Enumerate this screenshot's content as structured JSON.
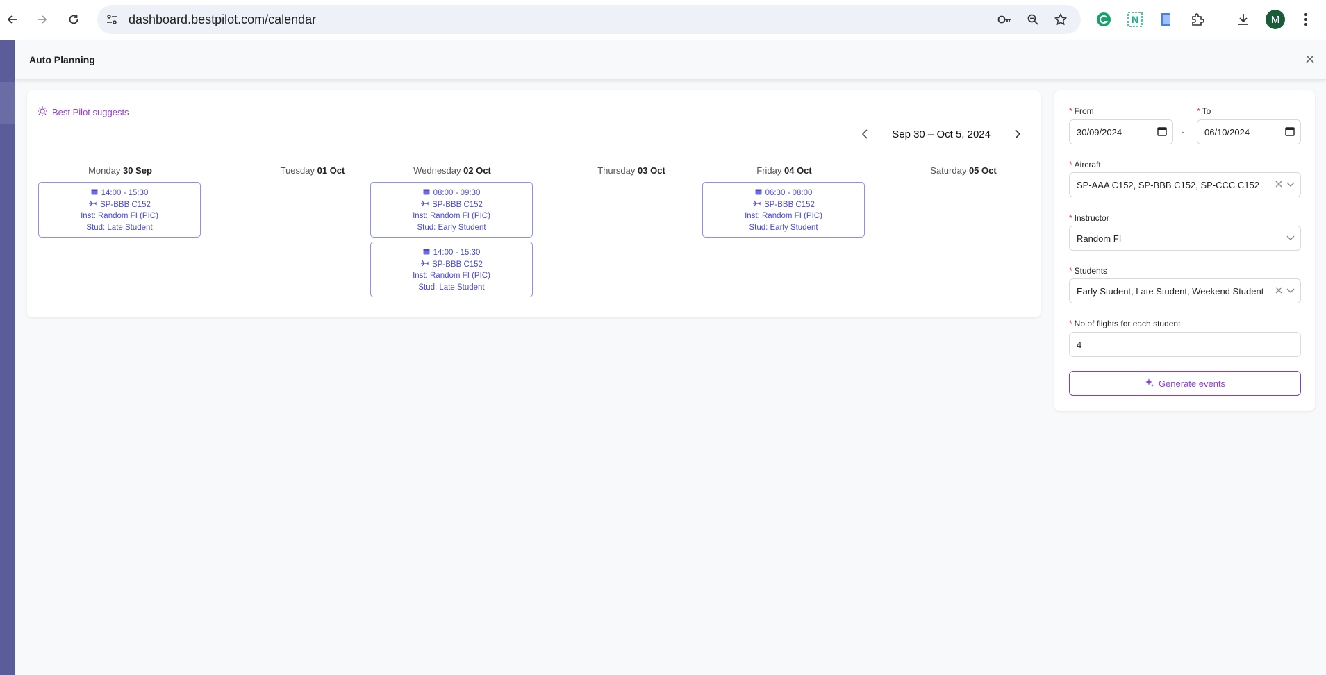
{
  "browser": {
    "url": "dashboard.bestpilot.com/calendar",
    "profile_initial": "M",
    "icons": [
      "back-icon",
      "forward-icon",
      "reload-icon",
      "site-settings-icon",
      "password-key-icon",
      "zoom-icon",
      "bookmark-star-icon",
      "grammarly-icon",
      "notion-icon",
      "extension-icon",
      "puzzle-icon",
      "download-icon",
      "menu-kebab-icon"
    ]
  },
  "drawer": {
    "title": "Auto Planning"
  },
  "calendar": {
    "suggest_label": "Best Pilot suggests",
    "week_range": "Sep 30 – Oct 5, 2024",
    "days": [
      {
        "weekday": "Monday",
        "date": "30 Sep"
      },
      {
        "weekday": "Tuesday",
        "date": "01 Oct"
      },
      {
        "weekday": "Wednesday",
        "date": "02 Oct"
      },
      {
        "weekday": "Thursday",
        "date": "03 Oct"
      },
      {
        "weekday": "Friday",
        "date": "04 Oct"
      },
      {
        "weekday": "Saturday",
        "date": "05 Oct"
      }
    ],
    "events": [
      {
        "day": "Monday",
        "time": "14:00 - 15:30",
        "aircraft": "SP-BBB C152",
        "inst": "Inst: Random FI (PIC)",
        "stud": "Stud: Late Student"
      },
      {
        "day": "Wednesday",
        "time": "08:00 - 09:30",
        "aircraft": "SP-BBB C152",
        "inst": "Inst: Random FI (PIC)",
        "stud": "Stud: Early Student"
      },
      {
        "day": "Wednesday",
        "time": "14:00 - 15:30",
        "aircraft": "SP-BBB C152",
        "inst": "Inst: Random FI (PIC)",
        "stud": "Stud: Late Student"
      },
      {
        "day": "Friday",
        "time": "06:30 - 08:00",
        "aircraft": "SP-BBB C152",
        "inst": "Inst: Random FI (PIC)",
        "stud": "Stud: Early Student"
      }
    ]
  },
  "form": {
    "from_label": "From",
    "from_value": "30/09/2024",
    "range_dash": "-",
    "to_label": "To",
    "to_value": "06/10/2024",
    "aircraft_label": "Aircraft",
    "aircraft_value": "SP-AAA C152, SP-BBB C152, SP-CCC C152",
    "instructor_label": "Instructor",
    "instructor_value": "Random FI",
    "students_label": "Students",
    "students_value": "Early Student, Late Student, Weekend Student",
    "flights_label": "No of flights for each student",
    "flights_value": "4",
    "generate_label": "Generate events"
  },
  "colors": {
    "accent_purple": "#8a3fd8",
    "event_blue": "#4a4ad6",
    "required_red": "#e0333a",
    "sidebar": "#5b5d9a"
  }
}
